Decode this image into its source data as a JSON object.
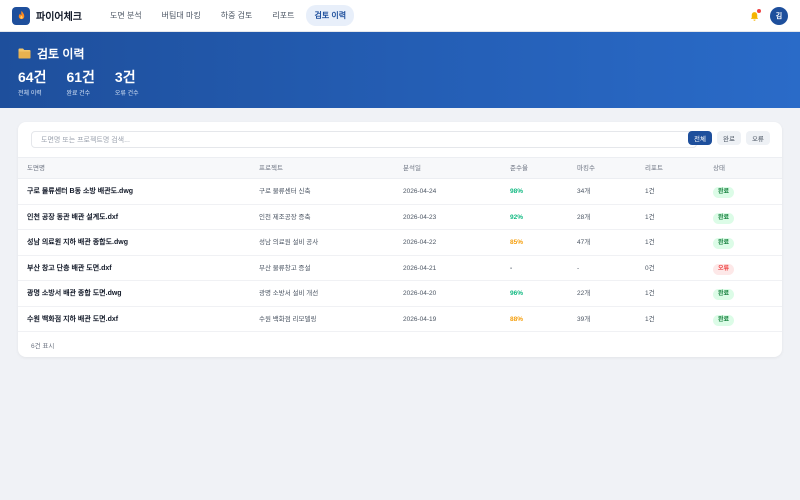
{
  "app": {
    "name": "파이어체크"
  },
  "nav": {
    "items": [
      "도면 분석",
      "버팀대 마킹",
      "하중 검토",
      "리포트",
      "검토 이력"
    ],
    "active_index": 4
  },
  "user": {
    "avatar_initial": "김"
  },
  "hero": {
    "title": "검토 이력",
    "stats": [
      {
        "value": "64건",
        "label": "전체 이력"
      },
      {
        "value": "61건",
        "label": "완료 건수"
      },
      {
        "value": "3건",
        "label": "오류 건수"
      }
    ]
  },
  "search": {
    "placeholder": "도면명 또는 프로젝트명 검색..."
  },
  "filters": [
    {
      "label": "전체",
      "active": true
    },
    {
      "label": "완료",
      "active": false
    },
    {
      "label": "오류",
      "active": false
    }
  ],
  "table": {
    "columns": [
      "도면명",
      "프로젝트",
      "분석일",
      "준수율",
      "마킹수",
      "리포트",
      "상태"
    ],
    "rows": [
      {
        "file": "구로 물류센터 B동 소방 배관도.dwg",
        "project": "구로 물류센터 신축",
        "date": "2026-04-24",
        "rate": "98%",
        "rate_color": "#10b981",
        "marks": "34개",
        "reports": "1건",
        "status": "완료"
      },
      {
        "file": "인천 공장 동관 배관 설계도.dxf",
        "project": "인천 제조공장 증축",
        "date": "2026-04-23",
        "rate": "92%",
        "rate_color": "#10b981",
        "marks": "28개",
        "reports": "1건",
        "status": "완료"
      },
      {
        "file": "성남 의료원 지하 배관 종합도.dwg",
        "project": "성남 의료원 설비 공사",
        "date": "2026-04-22",
        "rate": "85%",
        "rate_color": "#f59e0b",
        "marks": "47개",
        "reports": "1건",
        "status": "완료"
      },
      {
        "file": "부산 창고 단층 배관 도면.dxf",
        "project": "부산 물류창고 증설",
        "date": "2026-04-21",
        "rate": "-",
        "rate_color": "#4b5563",
        "marks": "-",
        "reports": "0건",
        "status": "오류"
      },
      {
        "file": "광명 소방서 배관 종합 도면.dwg",
        "project": "광명 소방서 설비 개선",
        "date": "2026-04-20",
        "rate": "96%",
        "rate_color": "#10b981",
        "marks": "22개",
        "reports": "1건",
        "status": "완료"
      },
      {
        "file": "수원 백화점 지하 배관 도면.dxf",
        "project": "수원 백화점 리모델링",
        "date": "2026-04-19",
        "rate": "88%",
        "rate_color": "#f59e0b",
        "marks": "39개",
        "reports": "1건",
        "status": "완료"
      }
    ]
  },
  "footer": {
    "count_text": "6건 표시"
  },
  "colors": {
    "primary": "#1e4f9c",
    "success": "#10b981",
    "warning": "#f59e0b",
    "danger": "#ef4444"
  }
}
